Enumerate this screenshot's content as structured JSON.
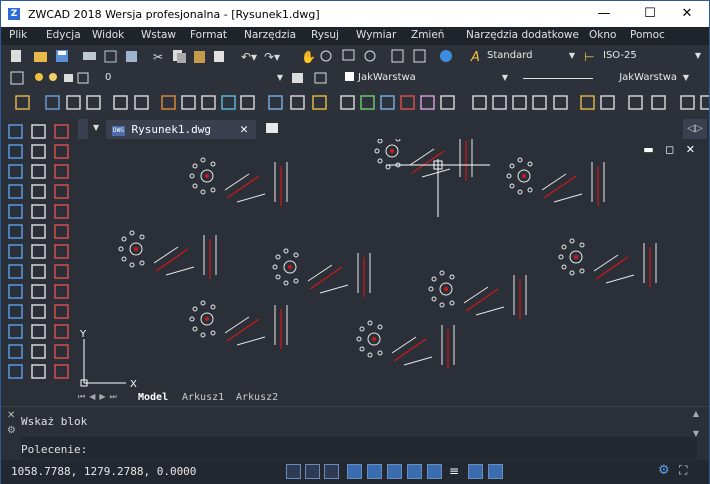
{
  "title": {
    "app": "ZWCAD 2018 Wersja profesjonalna - [Rysunek1.dwg]",
    "minimize": "—",
    "maximize": "☐",
    "close": "✕"
  },
  "menu": [
    "Plik",
    "Edycja",
    "Widok",
    "Wstaw",
    "Format",
    "Narzędzia",
    "Rysuj",
    "Wymiar",
    "Zmień",
    "Narzędzia dodatkowe",
    "Okno",
    "Pomoc"
  ],
  "toolbar1": {
    "text_style": "Standard",
    "dim_style": "ISO-25"
  },
  "toolbar2": {
    "layer": "0",
    "color": "JakWarstwa",
    "linetype": "JakWarstwa"
  },
  "document": {
    "tab": "Rysunek1.dwg",
    "close": "✕"
  },
  "layouts": [
    "Model",
    "Arkusz1",
    "Arkusz2"
  ],
  "ucs": {
    "x": "X",
    "y": "Y"
  },
  "command": {
    "history": "Wskaż blok",
    "prompt": "Polecenie:"
  },
  "status": {
    "coords": "1058.7788, 1279.2788, 0.0000"
  },
  "colors": {
    "accent_red": "#d01818",
    "background": "#2a2f38"
  }
}
